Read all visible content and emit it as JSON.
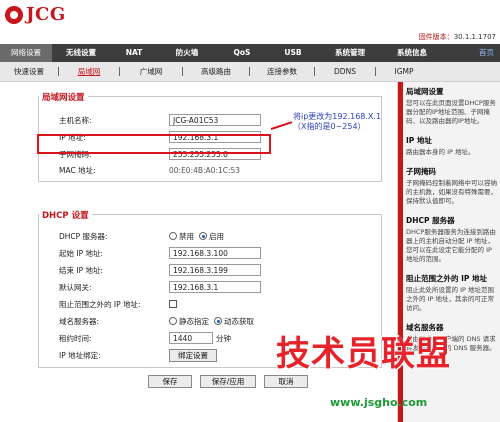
{
  "header": {
    "logo_text": "JCG",
    "fw_label": "固件版本：",
    "fw_version": "30.1.1.1707"
  },
  "main_nav": {
    "items": [
      "网络设置",
      "无线设置",
      "NAT",
      "防火墙",
      "QoS",
      "USB",
      "系统管理",
      "系统信息"
    ],
    "home": "首页"
  },
  "sub_nav": {
    "items": [
      "快速设置",
      "局域网",
      "广域网",
      "高级路由",
      "连接参数",
      "DDNS",
      "IGMP"
    ]
  },
  "lan": {
    "title": "局域网设置",
    "host_label": "主机名称:",
    "host_value": "JCG-A01C53",
    "ip_label": "IP 地址:",
    "ip_value": "192.168.3.1",
    "mask_label": "子网掩码:",
    "mask_value": "255.255.255.0",
    "mac_label": "MAC 地址:",
    "mac_value": "00:E0:4B:A0:1C:53"
  },
  "annotation": {
    "text": "将ip更改为192.168.X.1（X指的是0~254）"
  },
  "dhcp": {
    "title": "DHCP 设置",
    "server_label": "DHCP 服务器:",
    "disable": "禁用",
    "enable": "启用",
    "start_label": "起始 IP 地址:",
    "start_value": "192.168.3.100",
    "end_label": "结束 IP 地址:",
    "end_value": "192.168.3.199",
    "gw_label": "默认网关:",
    "gw_value": "192.168.3.1",
    "block_label": "阻止范围之外的 IP 地址:",
    "dns_label": "域名服务器:",
    "dns_static": "静态指定",
    "dns_auto": "动态获取",
    "lease_label": "租约时间:",
    "lease_value": "1440",
    "lease_unit": "分钟",
    "bind_label": "IP 地址绑定:",
    "bind_button": "绑定设置"
  },
  "actions": {
    "save": "保存",
    "save_apply": "保存/应用",
    "cancel": "取消"
  },
  "help": {
    "items": [
      {
        "title": "局域网设置",
        "text": "您可以在此页面设置DHCP服务器分配的IP地址范围、子网掩码、以及路由器的IP地址。"
      },
      {
        "title": "IP 地址",
        "text": "路由器本身的 IP 地址。"
      },
      {
        "title": "子网掩码",
        "text": "子网掩码控制着网络中可以容纳的主机数，如果没有特殊需要，保持默认值即可。"
      },
      {
        "title": "DHCP 服务器",
        "text": "DHCP服务器服务为连接到路由器上的主机自动分配 IP 地址，您可以在此设定它能分配的 IP 地址的范围。"
      },
      {
        "title": "阻止范围之外的 IP 地址",
        "text": "阻止此处所设置的 IP 地址范围之外的 IP 地址，其余的可正常访问。"
      },
      {
        "title": "域名服务器",
        "text": "路由器会将客户端的 DNS 请求转发到所指定的 DNS 服务器。"
      }
    ]
  },
  "watermark": {
    "big": "技术员联盟",
    "url": "www.jsgho.com"
  }
}
